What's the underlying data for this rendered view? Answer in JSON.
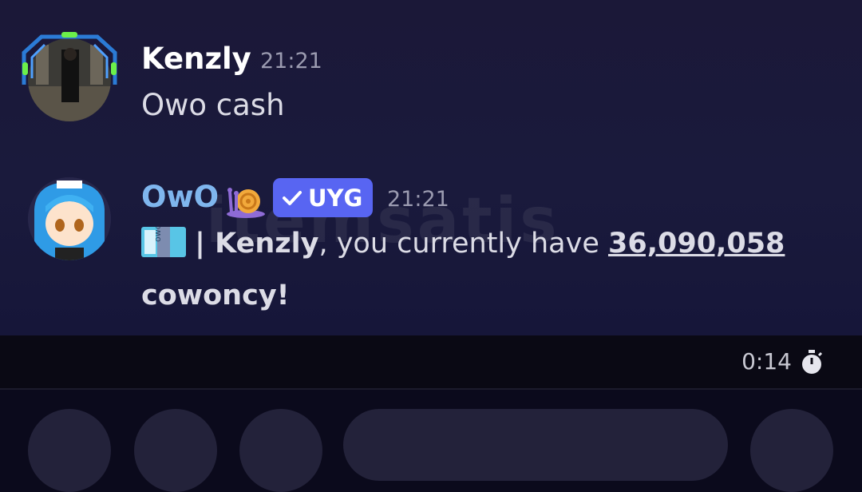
{
  "messages": [
    {
      "username": "Kenzly",
      "time": "21:21",
      "text": "Owo cash",
      "name_color": "#ffffff"
    },
    {
      "username": "OwO",
      "time": "21:21",
      "badge": "UYG",
      "name_color": "#7fb6ee",
      "text_segments": {
        "sep": "| ",
        "user": "Kenzly",
        "mid": ", you currently have ",
        "amount": "36,090,058",
        "end": "cowoncy!"
      }
    }
  ],
  "watermark": "itemsatis",
  "timer": "0:14",
  "colors": {
    "badge": "#5865f2",
    "background": "#1b1838"
  }
}
